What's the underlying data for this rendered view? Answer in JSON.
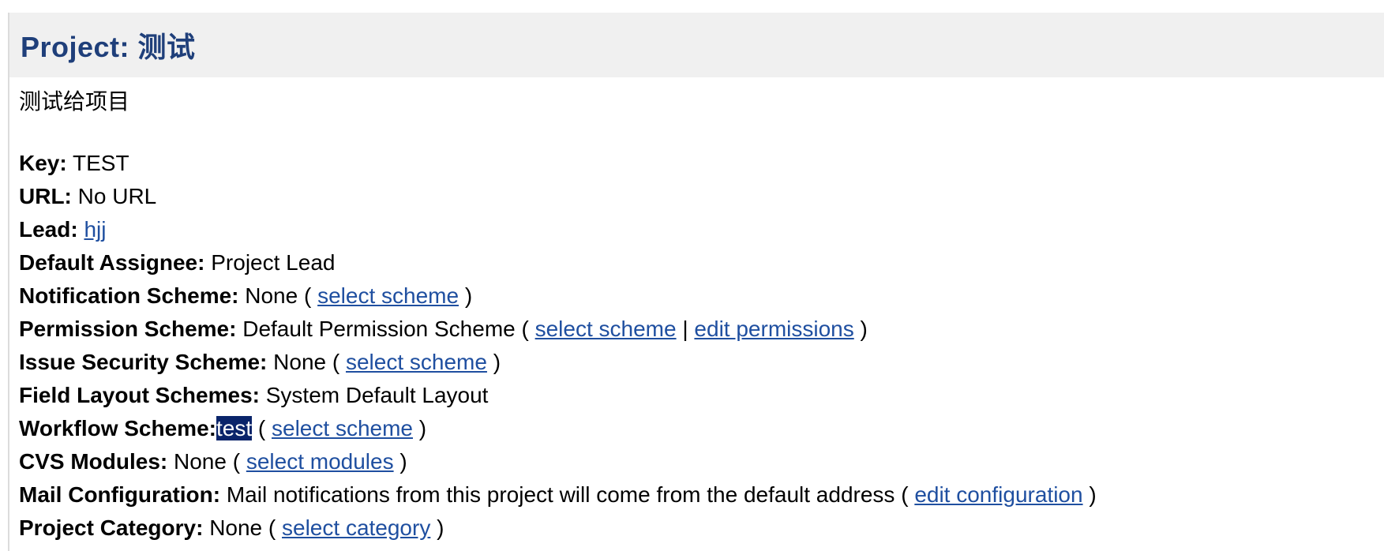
{
  "header": {
    "title": "Project: 测试"
  },
  "description": "测试给项目",
  "fields": {
    "key": {
      "label": "Key:",
      "value": "TEST"
    },
    "url": {
      "label": "URL:",
      "value": "No URL"
    },
    "lead": {
      "label": "Lead:",
      "link": "hjj"
    },
    "default_assignee": {
      "label": "Default Assignee:",
      "value": "Project Lead"
    },
    "notification_scheme": {
      "label": "Notification Scheme:",
      "value": "None",
      "link": "select scheme"
    },
    "permission_scheme": {
      "label": "Permission Scheme:",
      "value": "Default Permission Scheme",
      "link1": "select scheme",
      "separator": "|",
      "link2": "edit permissions"
    },
    "issue_security_scheme": {
      "label": "Issue Security Scheme:",
      "value": "None",
      "link": "select scheme"
    },
    "field_layout_schemes": {
      "label": "Field Layout Schemes:",
      "value": "System Default Layout"
    },
    "workflow_scheme": {
      "label": "Workflow Scheme:",
      "value": "test",
      "link": "select scheme"
    },
    "cvs_modules": {
      "label": "CVS Modules:",
      "value": "None",
      "link": "select modules"
    },
    "mail_configuration": {
      "label": "Mail Configuration:",
      "value": "Mail notifications from this project will come from the default address",
      "link": "edit configuration"
    },
    "project_category": {
      "label": "Project Category:",
      "value": "None",
      "link": "select category"
    }
  },
  "colors": {
    "title": "#1f3f7a",
    "link": "#1f4fa0",
    "header_bg": "#f0f0f0",
    "selection_bg": "#0a246a"
  }
}
